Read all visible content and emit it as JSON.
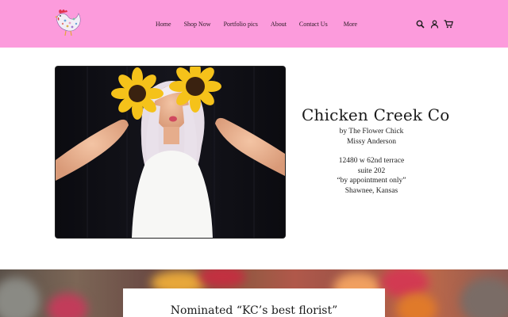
{
  "header": {
    "logo_icon": "chicken-logo-icon",
    "nav": [
      "Home",
      "Shop Now",
      "Portfolio pics",
      "About",
      "Contact Us",
      "More"
    ],
    "icons": [
      "search-icon",
      "user-icon",
      "cart-icon"
    ],
    "background": "#fc9bdc"
  },
  "hero": {
    "photo": "woman-with-sunflowers-photo",
    "title": "Chicken Creek Co",
    "line1": "by The Flower Chick",
    "line2": "Missy Anderson",
    "address1": "12480 w 62nd terrace",
    "address2": "suite 202",
    "address3": "“by appointment only”",
    "address4": "Shawnee, Kansas"
  },
  "banner": {
    "title": "Nominated “KC’s best florist”"
  }
}
